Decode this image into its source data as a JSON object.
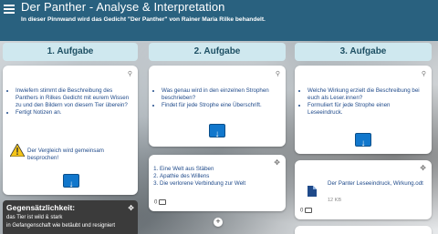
{
  "header": {
    "title": "Der Panther - Analyse & Interpretation",
    "subtitle": "In dieser Pinnwand wird das Gedicht \"Der Panther\" von Rainer Maria Rilke behandelt."
  },
  "columns": [
    {
      "label": "1. Aufgabe",
      "card": {
        "items": [
          "Inwiefern stimmt die Beschreibung des Panthers in Rilkes Gedicht mit eurem Wissen zu und den Bildern von diesem Tier überein?",
          "Fertigt Notizen an."
        ],
        "warning": "Der Vergleich wird gemeinsam besprochen!",
        "button_glyph": "↓"
      },
      "dark_card": {
        "title": "Gegensätzlichkeit:",
        "lines": [
          "das Tier ist wild & stark",
          "in Gefangenschaft wie betäubt und resigniert"
        ]
      }
    },
    {
      "label": "2. Aufgabe",
      "card": {
        "items": [
          "Was genau wird in den einzelnen Strophen beschrieben?",
          "Findet für jede Strophe eine Überschrift."
        ],
        "button_glyph": "↓"
      },
      "list_card": {
        "items": [
          "Eine Welt aus Stäben",
          "Apathie des Willens",
          "Die verlorene Verbindung zur Welt"
        ],
        "comment_count": "0"
      }
    },
    {
      "label": "3. Aufgabe",
      "card": {
        "items": [
          "Welche Wirkung erzielt die Beschreibung bei euch als Leser.innen?",
          "Formuliert für jede Strophe einen Leseeindruck."
        ],
        "button_glyph": "↓"
      },
      "file_card": {
        "file_name": "Der Panter Leseeindruck, Wirkung.odt",
        "file_size": "12 KB",
        "comment_count": "0"
      }
    }
  ],
  "icons": {
    "menu": "menu-icon",
    "search": "search-icon",
    "drag": "drag-icon",
    "comment": "comment-icon",
    "file": "file-icon",
    "warning": "warning-icon",
    "add": "add-icon"
  },
  "colors": {
    "header_bg": "#29617f",
    "column_header_bg": "#cfe8ef",
    "button_blue": "#1177cc",
    "dark_card_bg": "#3b3b3b"
  }
}
